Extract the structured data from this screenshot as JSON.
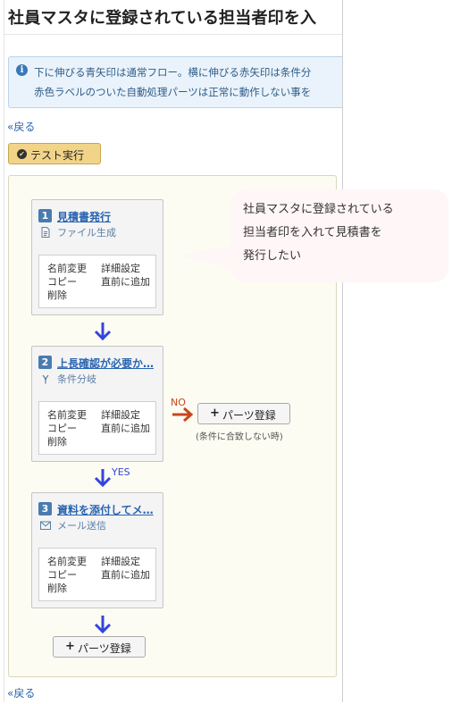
{
  "page_title": "社員マスタに登録されている担当者印を入",
  "info": {
    "line1": "下に伸びる青矢印は通常フロー。横に伸びる赤矢印は条件分",
    "line2": "赤色ラベルのついた自動処理パーツは正常に動作しない事を"
  },
  "nav": {
    "back_label": "«戻る"
  },
  "test_button": {
    "label": "テスト実行"
  },
  "parts": [
    {
      "number": "1",
      "name": "見積書発行",
      "type": "ファイル生成",
      "type_icon": "document-icon",
      "menu": {
        "rename": "名前変更",
        "detail": "詳細設定",
        "copy": "コピー",
        "insert_before": "直前に追加",
        "delete": "削除"
      }
    },
    {
      "number": "2",
      "name": "上長確認が必要か…",
      "type": "条件分岐",
      "type_icon": "branch-icon",
      "menu": {
        "rename": "名前変更",
        "detail": "詳細設定",
        "copy": "コピー",
        "insert_before": "直前に追加",
        "delete": "削除"
      }
    },
    {
      "number": "3",
      "name": "資料を添付してメ…",
      "type": "メール送信",
      "type_icon": "envelope-icon",
      "menu": {
        "rename": "名前変更",
        "detail": "詳細設定",
        "copy": "コピー",
        "insert_before": "直前に追加",
        "delete": "削除"
      }
    }
  ],
  "branch": {
    "no_label": "NO",
    "yes_label": "YES",
    "register_label": "パーツ登録",
    "condition_note": "(条件に合致しない時)"
  },
  "bottom_register_label": "パーツ登録",
  "bubble": {
    "line1": "社員マスタに登録されている",
    "line2": "担当者印を入れて見積書を",
    "line3": "発行したい"
  },
  "colors": {
    "flow_arrow": "#3344dd",
    "branch_arrow": "#c8461c",
    "no_label": "#c8461c",
    "yes_label": "#3344dd",
    "test_button": "#f2d489",
    "canvas_bg": "#fdfcf2",
    "bubble_bg": "#fff6f7",
    "link": "#2a64b0"
  }
}
